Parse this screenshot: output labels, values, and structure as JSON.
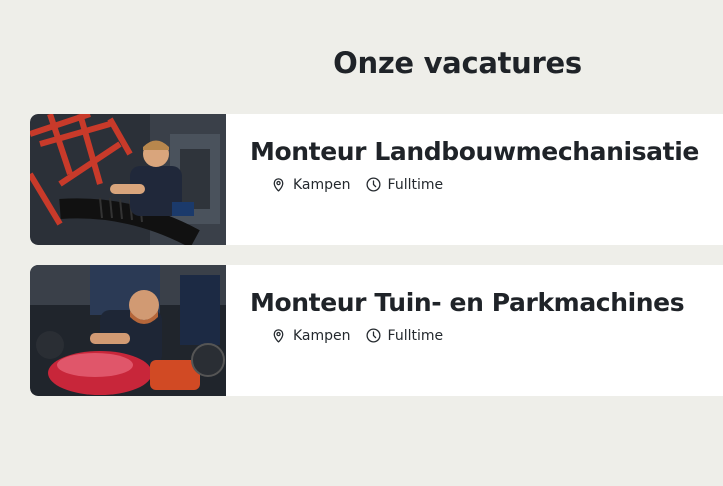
{
  "page": {
    "heading": "Onze vacatures"
  },
  "vacancies": [
    {
      "title": "Monteur Landbouwmechanisatie",
      "location_icon": "location-pin-icon",
      "location": "Kampen",
      "hours_icon": "clock-icon",
      "hours": "Fulltime"
    },
    {
      "title": "Monteur Tuin- en Parkmachines",
      "location_icon": "location-pin-icon",
      "location": "Kampen",
      "hours_icon": "clock-icon",
      "hours": "Fulltime"
    }
  ],
  "colors": {
    "background": "#eeeee9",
    "card": "#ffffff",
    "text": "#1f2328"
  }
}
